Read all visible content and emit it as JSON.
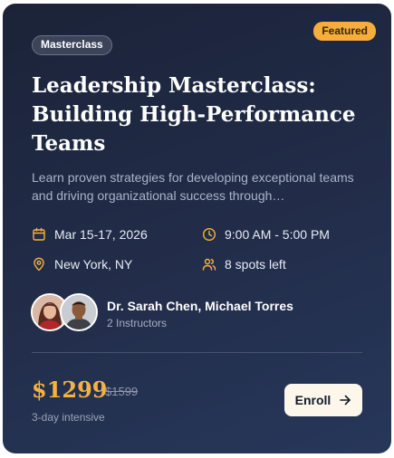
{
  "badge": {
    "featured": "Featured"
  },
  "category": "Masterclass",
  "title": "Leadership Masterclass: Building High-Performance Teams",
  "description": "Learn proven strategies for developing exceptional teams and driving organizational success through…",
  "details": {
    "date": "Mar 15-17, 2026",
    "time": "9:00 AM - 5:00 PM",
    "location": "New York, NY",
    "spots": "8 spots left"
  },
  "instructors": {
    "names": "Dr. Sarah Chen, Michael Torres",
    "count": "2 Instructors"
  },
  "pricing": {
    "price": "$1299",
    "original_price": "$1599",
    "duration": "3-day intensive"
  },
  "cta": {
    "label": "Enroll"
  },
  "icons": {
    "date": "calendar-icon",
    "time": "clock-icon",
    "location": "map-pin-icon",
    "spots": "users-icon",
    "cta": "arrow-right-icon"
  },
  "colors": {
    "accent": "#f6b23e",
    "card_bg": "#222d4a",
    "button_bg": "#fcf7ea"
  }
}
